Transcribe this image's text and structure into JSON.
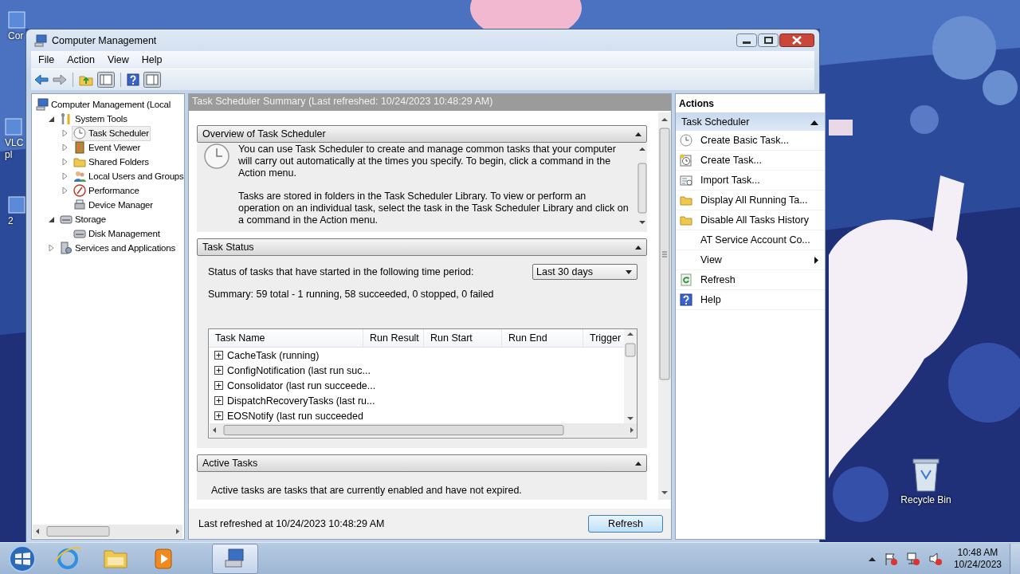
{
  "desktop": {
    "icons": [
      {
        "lines": [
          "Cor"
        ]
      },
      {
        "lines": [
          "VLC",
          "pl"
        ]
      },
      {
        "lines": [
          "2"
        ]
      },
      {
        "lines": [
          "Recycle Bin"
        ]
      }
    ]
  },
  "window": {
    "title": "Computer Management"
  },
  "menu": [
    "File",
    "Action",
    "View",
    "Help"
  ],
  "tree": [
    {
      "label": "Computer Management (Local",
      "selected": false,
      "children": [
        {
          "label": "System Tools",
          "selected": false,
          "expanded": true,
          "children": [
            {
              "label": "Task Scheduler",
              "selected": true,
              "expanded": false
            },
            {
              "label": "Event Viewer",
              "selected": false,
              "expanded": false
            },
            {
              "label": "Shared Folders",
              "selected": false,
              "expanded": false
            },
            {
              "label": "Local Users and Groups",
              "selected": false,
              "expanded": false
            },
            {
              "label": "Performance",
              "selected": false,
              "expanded": false
            },
            {
              "label": "Device Manager",
              "selected": false
            }
          ]
        },
        {
          "label": "Storage",
          "selected": false,
          "expanded": true,
          "children": [
            {
              "label": "Disk Management",
              "selected": false
            }
          ]
        },
        {
          "label": "Services and Applications",
          "selected": false,
          "expanded": false
        }
      ]
    }
  ],
  "center": {
    "header": "Task Scheduler Summary (Last refreshed: 10/24/2023 10:48:29 AM)",
    "sections": [
      {
        "kind": "overview",
        "title": "Overview of Task Scheduler",
        "expanded": true,
        "paragraphs": [
          "You can use Task Scheduler to create and manage common tasks that your computer will carry out automatically at the times you specify. To begin, click a command in the Action menu.",
          "Tasks are stored in folders in the Task Scheduler Library. To view or perform an operation on an individual task, select the task in the Task Scheduler Library and click on a command in the Action menu."
        ]
      },
      {
        "kind": "status",
        "title": "Task Status",
        "expanded": true,
        "period_label": "Status of tasks that have started in the following time period:",
        "period": "Last 30 days",
        "summary": "Summary: 59 total - 1 running, 58 succeeded, 0 stopped, 0 failed",
        "table": {
          "columns": [
            "Task Name",
            "Run Result",
            "Run Start",
            "Run End",
            "Trigger"
          ],
          "rows": [
            "CacheTask (running)",
            "ConfigNotification (last run suc...",
            "Consolidator (last run succeede...",
            "DispatchRecoveryTasks (last ru...",
            "EOSNotify (last run succeeded"
          ]
        }
      },
      {
        "kind": "active",
        "title": "Active Tasks",
        "expanded": true,
        "paragraphs": [
          "Active tasks are tasks that are currently enabled and have not expired."
        ]
      }
    ],
    "footer": {
      "text": "Last refreshed at 10/24/2023 10:48:29 AM",
      "button": "Refresh"
    }
  },
  "actions": {
    "title": "Actions",
    "group": {
      "label": "Task Scheduler",
      "expanded": true
    },
    "items": [
      {
        "label": "Create Basic Task...",
        "submenu": false
      },
      {
        "label": "Create Task...",
        "submenu": false
      },
      {
        "label": "Import Task...",
        "submenu": false
      },
      {
        "label": "Display All Running Ta...",
        "submenu": false
      },
      {
        "label": "Disable All Tasks History",
        "submenu": false
      },
      {
        "label": "AT Service Account Co...",
        "submenu": false
      },
      {
        "label": "View",
        "submenu": true
      },
      {
        "label": "Refresh",
        "submenu": false
      },
      {
        "label": "Help",
        "submenu": false
      }
    ]
  },
  "taskbar": {
    "apps": [
      {
        "selected": false
      },
      {
        "selected": false
      },
      {
        "selected": false
      },
      {
        "selected": true
      }
    ],
    "clock": {
      "time": "10:48 AM",
      "date": "10/24/2023"
    }
  }
}
